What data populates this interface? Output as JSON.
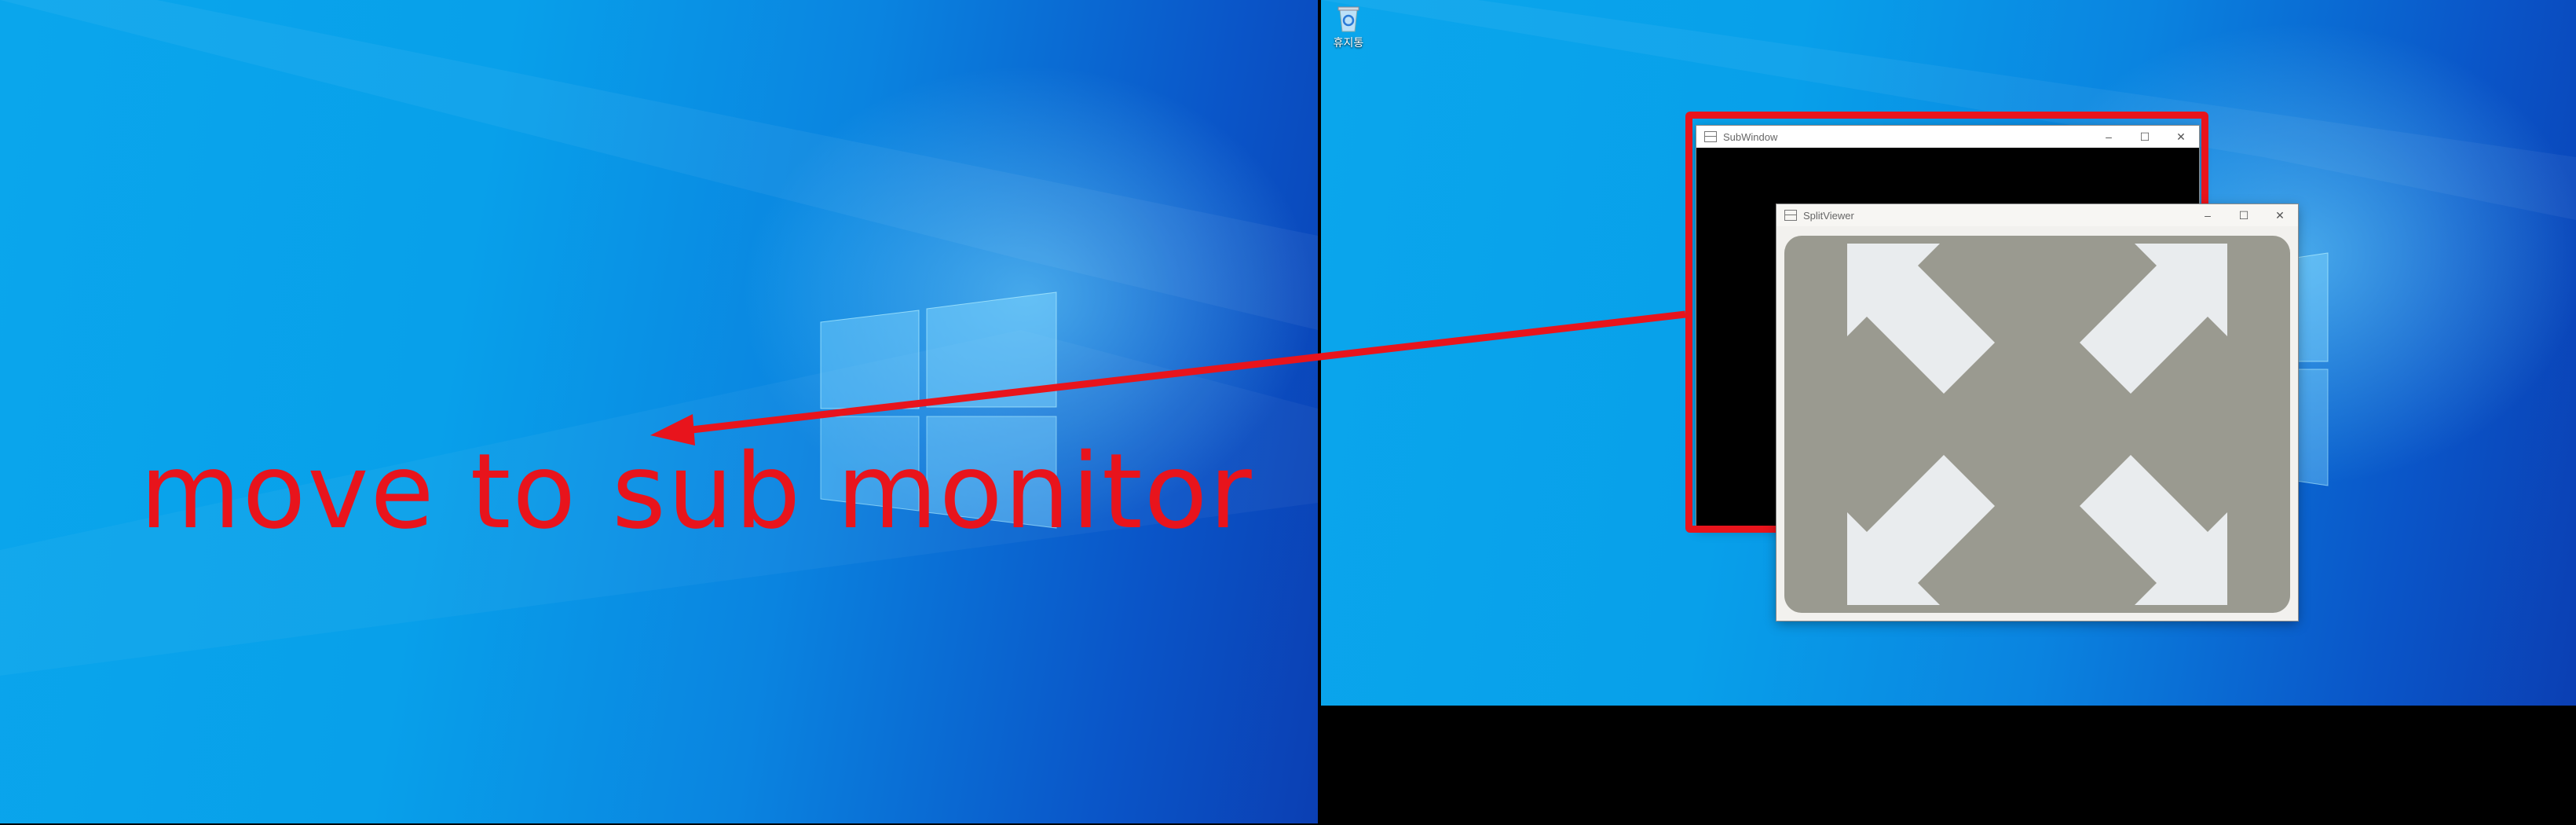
{
  "desktop": {
    "recycle_bin_label": "휴지통"
  },
  "windows": {
    "sub_window": {
      "title": "SubWindow",
      "minimize": "–",
      "maximize": "☐",
      "close": "✕"
    },
    "split_viewer": {
      "title": "SplitViewer",
      "minimize": "–",
      "maximize": "☐",
      "close": "✕"
    }
  },
  "annotation": {
    "caption": "move to sub monitor",
    "color": "#e8141c"
  },
  "icons": {
    "app_icon": "window-split-icon",
    "recycle_bin": "recycle-bin-icon",
    "expand": "expand-arrows-icon"
  }
}
